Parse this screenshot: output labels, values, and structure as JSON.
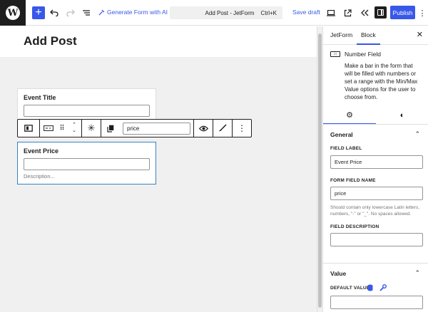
{
  "topbar": {
    "generate_label": "Generate Form with AI",
    "doc_title": "Add Post - JetForm",
    "shortcut": "Ctrl+K",
    "save_draft": "Save draft",
    "publish": "Publish"
  },
  "canvas": {
    "post_title": "Add Post",
    "event_title_label": "Event Title",
    "event_price_label": "Event Price",
    "description_placeholder": "Description...",
    "toolbar_field_value": "price"
  },
  "sidebar": {
    "tabs": [
      "JetForm",
      "Block"
    ],
    "block_name": "Number Field",
    "block_description": "Make a bar in the form that will be filled with numbers or set a range with the Min/Max Value options for the user to choose from.",
    "general_title": "General",
    "field_label_label": "FIELD LABEL",
    "field_label_value": "Event Price",
    "form_field_name_label": "FORM FIELD NAME",
    "form_field_name_value": "price",
    "form_field_name_help": "Should contain only lowercase Latin letters, numbers, \"-\" or \"_\". No spaces allowed.",
    "field_description_label": "FIELD DESCRIPTION",
    "value_title": "Value",
    "default_value_label": "DEFAULT VALUE"
  },
  "colors": {
    "accent": "#3858e9",
    "selection": "#3582c4",
    "dark": "#1e1e1e"
  }
}
